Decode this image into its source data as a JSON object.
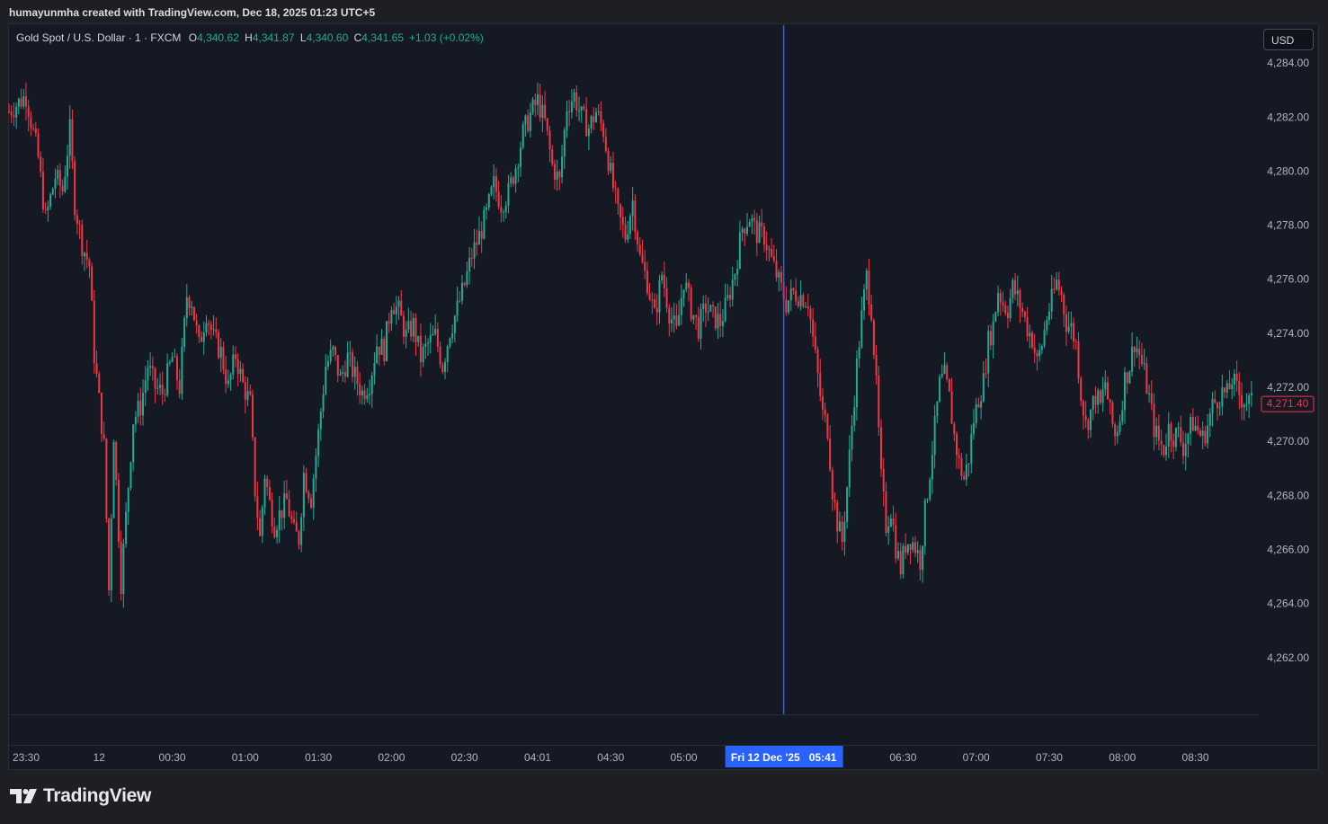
{
  "header": {
    "credit": "humayunmha created with TradingView.com, Dec 18, 2025 01:23 UTC+5"
  },
  "legend": {
    "symbol": "Gold Spot / U.S. Dollar · 1 · FXCM",
    "open_label": "O",
    "open": "4,340.62",
    "high_label": "H",
    "high": "4,341.87",
    "low_label": "L",
    "low": "4,340.60",
    "close_label": "C",
    "close": "4,341.65",
    "change": "+1.03 (+0.02%)"
  },
  "currency_button": "USD",
  "price_label": "4,271.40",
  "crosshair_time_label": "Fri 12 Dec '25   05:41",
  "brand": "TradingView",
  "colors": {
    "up": "#22ab94",
    "down": "#f23645",
    "background": "#151924",
    "crosshair": "#2962ff",
    "text": "#b2b5be"
  },
  "chart_data": {
    "type": "candlestick",
    "y_tick_labels": [
      "4,284.00",
      "4,282.00",
      "4,280.00",
      "4,278.00",
      "4,276.00",
      "4,274.00",
      "4,272.00",
      "4,270.00",
      "4,268.00",
      "4,266.00",
      "4,264.00",
      "4,262.00"
    ],
    "y_ticks": [
      4284,
      4282,
      4280,
      4278,
      4276,
      4274,
      4272,
      4270,
      4268,
      4266,
      4264,
      4262
    ],
    "ylim": [
      4259.9,
      4285.4
    ],
    "x_tick_labels": [
      "23:30",
      "12",
      "00:30",
      "01:00",
      "01:30",
      "02:00",
      "02:30",
      "04:01",
      "04:30",
      "05:00",
      "06:30",
      "07:00",
      "07:30",
      "08:00",
      "08:30"
    ],
    "x_tick_minutes": [
      -30,
      0,
      30,
      60,
      90,
      120,
      150,
      180,
      210,
      240,
      330,
      360,
      390,
      420,
      450
    ],
    "xlim_minutes": [
      -37,
      476
    ],
    "crosshair_minute": 281,
    "last_price": 4271.4,
    "close_path": [
      [
        -37,
        4282.2
      ],
      [
        -30,
        4282.8
      ],
      [
        -25,
        4280.5
      ],
      [
        -22,
        4278.2
      ],
      [
        -18,
        4279.8
      ],
      [
        -15,
        4279.3
      ],
      [
        -12,
        4281.5
      ],
      [
        -10,
        4278.8
      ],
      [
        -7,
        4277.3
      ],
      [
        -4,
        4276.5
      ],
      [
        -2,
        4273.2
      ],
      [
        2,
        4269.8
      ],
      [
        4,
        4264.5
      ],
      [
        6,
        4270.3
      ],
      [
        9,
        4264.8
      ],
      [
        11,
        4267.2
      ],
      [
        14,
        4270.8
      ],
      [
        17,
        4271.3
      ],
      [
        20,
        4272.8
      ],
      [
        23,
        4272.0
      ],
      [
        26,
        4271.8
      ],
      [
        30,
        4273.1
      ],
      [
        33,
        4272.0
      ],
      [
        36,
        4275.4
      ],
      [
        38,
        4275.2
      ],
      [
        41,
        4273.5
      ],
      [
        44,
        4274.8
      ],
      [
        47,
        4273.8
      ],
      [
        50,
        4273.3
      ],
      [
        53,
        4272.0
      ],
      [
        56,
        4273.2
      ],
      [
        59,
        4272.1
      ],
      [
        62,
        4271.4
      ],
      [
        64,
        4268.2
      ],
      [
        66,
        4266.4
      ],
      [
        68,
        4268.8
      ],
      [
        70,
        4267.7
      ],
      [
        72,
        4266.9
      ],
      [
        74,
        4267.3
      ],
      [
        77,
        4267.8
      ],
      [
        80,
        4266.6
      ],
      [
        82,
        4266.4
      ],
      [
        84,
        4268.8
      ],
      [
        87,
        4267.9
      ],
      [
        90,
        4270.3
      ],
      [
        93,
        4272.8
      ],
      [
        96,
        4273.3
      ],
      [
        99,
        4272.3
      ],
      [
        102,
        4273.1
      ],
      [
        105,
        4272.4
      ],
      [
        108,
        4271.8
      ],
      [
        111,
        4272.2
      ],
      [
        114,
        4273.6
      ],
      [
        117,
        4273.4
      ],
      [
        120,
        4275.2
      ],
      [
        123,
        4274.8
      ],
      [
        126,
        4273.9
      ],
      [
        129,
        4274.3
      ],
      [
        132,
        4273.1
      ],
      [
        135,
        4273.6
      ],
      [
        138,
        4273.9
      ],
      [
        141,
        4272.8
      ],
      [
        144,
        4274.1
      ],
      [
        147,
        4274.9
      ],
      [
        150,
        4275.8
      ],
      [
        153,
        4276.9
      ],
      [
        156,
        4277.6
      ],
      [
        159,
        4278.4
      ],
      [
        162,
        4279.5
      ],
      [
        165,
        4278.8
      ],
      [
        168,
        4279.2
      ],
      [
        171,
        4280.2
      ],
      [
        174,
        4281.4
      ],
      [
        177,
        4282.1
      ],
      [
        180,
        4282.6
      ],
      [
        183,
        4281.8
      ],
      [
        186,
        4280.2
      ],
      [
        189,
        4279.6
      ],
      [
        192,
        4282.4
      ],
      [
        195,
        4282.8
      ],
      [
        198,
        4282.0
      ],
      [
        201,
        4281.6
      ],
      [
        204,
        4282.2
      ],
      [
        207,
        4281.5
      ],
      [
        210,
        4279.9
      ],
      [
        213,
        4278.4
      ],
      [
        216,
        4277.6
      ],
      [
        219,
        4278.9
      ],
      [
        222,
        4276.8
      ],
      [
        225,
        4275.9
      ],
      [
        228,
        4274.6
      ],
      [
        231,
        4276.2
      ],
      [
        234,
        4274.8
      ],
      [
        237,
        4274.0
      ],
      [
        240,
        4276.0
      ],
      [
        243,
        4274.9
      ],
      [
        246,
        4274.2
      ],
      [
        249,
        4275.0
      ],
      [
        252,
        4274.6
      ],
      [
        255,
        4274.4
      ],
      [
        258,
        4275.2
      ],
      [
        261,
        4276.3
      ],
      [
        264,
        4277.9
      ],
      [
        267,
        4278.3
      ],
      [
        270,
        4277.7
      ],
      [
        273,
        4277.6
      ],
      [
        276,
        4276.7
      ],
      [
        279,
        4275.9
      ],
      [
        282,
        4275.1
      ],
      [
        285,
        4275.5
      ],
      [
        288,
        4275.4
      ],
      [
        291,
        4275.2
      ],
      [
        293,
        4273.8
      ],
      [
        295,
        4272.4
      ],
      [
        297,
        4271.0
      ],
      [
        299,
        4270.5
      ],
      [
        301,
        4268.2
      ],
      [
        303,
        4267.0
      ],
      [
        305,
        4266.3
      ],
      [
        307,
        4268.3
      ],
      [
        309,
        4270.6
      ],
      [
        311,
        4272.8
      ],
      [
        313,
        4274.6
      ],
      [
        315,
        4276.1
      ],
      [
        317,
        4274.9
      ],
      [
        319,
        4272.0
      ],
      [
        321,
        4268.6
      ],
      [
        323,
        4266.9
      ],
      [
        325,
        4267.5
      ],
      [
        327,
        4266.1
      ],
      [
        329,
        4265.3
      ],
      [
        331,
        4266.2
      ],
      [
        333,
        4266.4
      ],
      [
        335,
        4266.1
      ],
      [
        337,
        4265.6
      ],
      [
        339,
        4267.4
      ],
      [
        341,
        4268.9
      ],
      [
        343,
        4270.5
      ],
      [
        345,
        4272.1
      ],
      [
        347,
        4272.4
      ],
      [
        349,
        4271.6
      ],
      [
        351,
        4270.2
      ],
      [
        353,
        4269.2
      ],
      [
        355,
        4268.6
      ],
      [
        357,
        4269.4
      ],
      [
        359,
        4270.8
      ],
      [
        361,
        4271.6
      ],
      [
        363,
        4272.2
      ],
      [
        365,
        4273.7
      ],
      [
        367,
        4274.3
      ],
      [
        369,
        4275.6
      ],
      [
        371,
        4275.1
      ],
      [
        373,
        4274.9
      ],
      [
        375,
        4275.7
      ],
      [
        377,
        4275.3
      ],
      [
        379,
        4274.8
      ],
      [
        381,
        4274.2
      ],
      [
        383,
        4273.8
      ],
      [
        385,
        4272.9
      ],
      [
        387,
        4273.6
      ],
      [
        389,
        4274.6
      ],
      [
        391,
        4275.2
      ],
      [
        393,
        4275.9
      ],
      [
        395,
        4275.4
      ],
      [
        397,
        4274.4
      ],
      [
        399,
        4274.2
      ],
      [
        401,
        4273.6
      ],
      [
        403,
        4271.8
      ],
      [
        405,
        4270.6
      ],
      [
        407,
        4271.1
      ],
      [
        409,
        4271.7
      ],
      [
        411,
        4271.3
      ],
      [
        413,
        4272.2
      ],
      [
        415,
        4271.0
      ],
      [
        417,
        4270.2
      ],
      [
        419,
        4270.9
      ],
      [
        421,
        4272.3
      ],
      [
        423,
        4272.8
      ],
      [
        425,
        4273.7
      ],
      [
        427,
        4273.2
      ],
      [
        429,
        4272.5
      ],
      [
        431,
        4271.6
      ],
      [
        433,
        4270.5
      ],
      [
        435,
        4270.0
      ],
      [
        437,
        4269.7
      ],
      [
        439,
        4270.5
      ],
      [
        441,
        4270.2
      ],
      [
        443,
        4270.3
      ],
      [
        445,
        4269.8
      ],
      [
        447,
        4270.3
      ],
      [
        449,
        4270.7
      ],
      [
        451,
        4270.4
      ],
      [
        453,
        4270.1
      ],
      [
        455,
        4270.6
      ],
      [
        457,
        4271.3
      ],
      [
        459,
        4271.6
      ],
      [
        461,
        4271.8
      ],
      [
        463,
        4271.7
      ],
      [
        465,
        4272.3
      ],
      [
        467,
        4271.9
      ],
      [
        469,
        4271.6
      ],
      [
        471,
        4271.5
      ],
      [
        473,
        4271.4
      ]
    ]
  }
}
